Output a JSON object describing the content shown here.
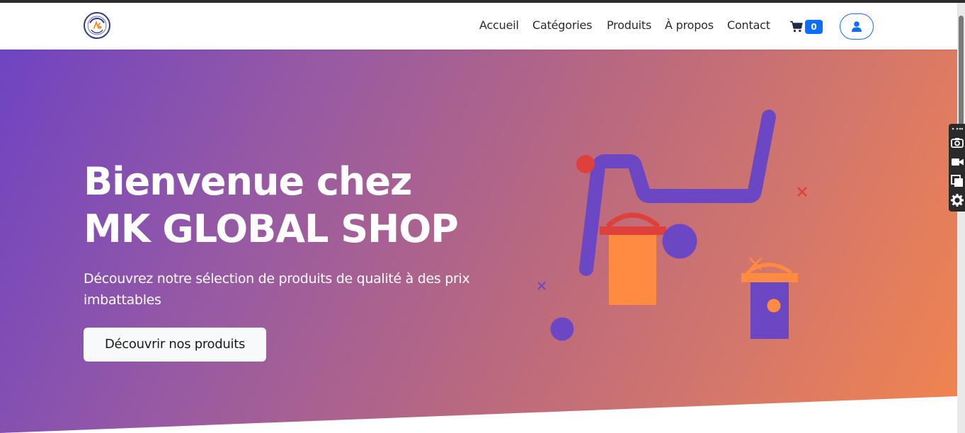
{
  "brand": {
    "logo_icon": "mk-global-shop-logo"
  },
  "nav": {
    "items": [
      {
        "label": "Accueil"
      },
      {
        "label": "Catégories"
      },
      {
        "label": "Produits"
      },
      {
        "label": "À propos"
      },
      {
        "label": "Contact"
      }
    ],
    "cart": {
      "icon": "cart-icon",
      "count": "0"
    },
    "user": {
      "icon": "user-icon"
    }
  },
  "hero": {
    "title_line1": "Bienvenue chez",
    "title_line2": "MK GLOBAL SHOP",
    "subtitle": "Découvrez notre sélection de produits de qualité à des prix imbattables",
    "cta_label": "Découvrir nos produits",
    "gradient_start": "#6f44c2",
    "gradient_end": "#f2844e"
  },
  "side_toolbar": {
    "icons": [
      "camera-icon",
      "video-icon",
      "copy-icon",
      "gear-icon"
    ]
  },
  "colors": {
    "accent": "#0d6efd",
    "illustration_purple": "#6b47c4",
    "illustration_orange": "#ff8a42",
    "illustration_red": "#e0403c"
  }
}
